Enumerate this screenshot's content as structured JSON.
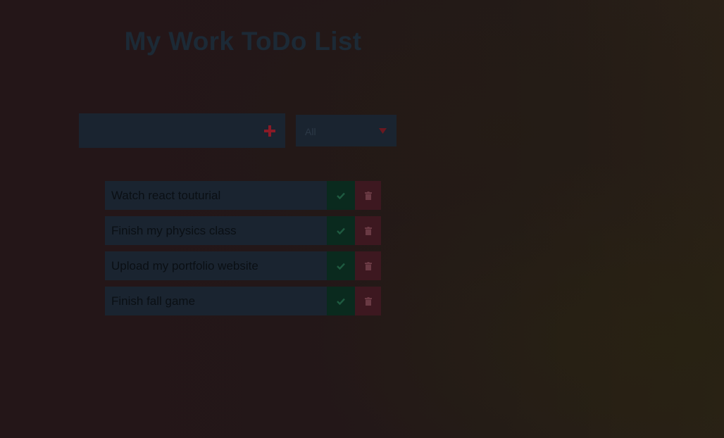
{
  "header": {
    "title": "My Work ToDo List"
  },
  "form": {
    "input_value": "",
    "add_icon": "plus-icon",
    "filter": {
      "selected": "All",
      "icon": "caret-down-icon"
    }
  },
  "todos": [
    {
      "text": "Watch react touturial"
    },
    {
      "text": "Finish my physics class"
    },
    {
      "text": "Upload my portfolio website"
    },
    {
      "text": "Finish fall game"
    }
  ],
  "icons": {
    "complete": "check-icon",
    "delete": "trash-icon"
  },
  "colors": {
    "panel": "#1a2430",
    "complete": "#0a2a1e",
    "delete": "#3d1820",
    "accent": "#8a1a26"
  }
}
